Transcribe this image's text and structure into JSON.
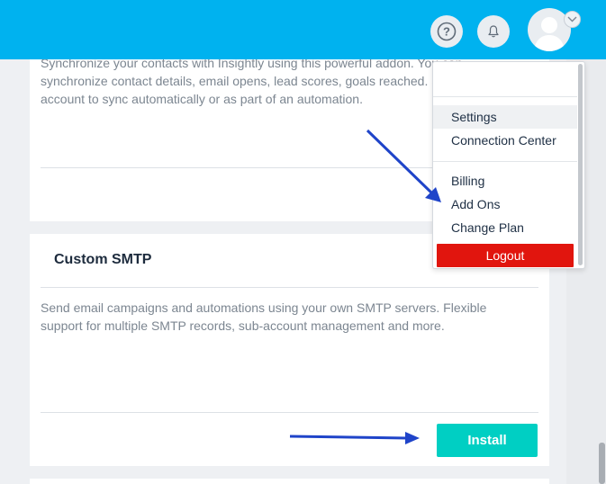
{
  "header": {
    "help_icon": "question-circle-icon",
    "bell_icon": "bell-icon",
    "avatar_icon": "user-avatar",
    "caret_icon": "chevron-down-icon",
    "bg_color": "#00b2ef"
  },
  "cards": [
    {
      "description": "Synchronize your contacts with Insightly using this powerful addon. You can synchronize contact details, email opens, lead scores, goals reached. Setup the account to sync automatically or as part of an automation."
    },
    {
      "title": "Custom SMTP",
      "description": "Send email campaigns and automations using your own SMTP servers. Flexible support for multiple SMTP records, sub-account management and more.",
      "button_label": "Install",
      "button_color": "#00cfc3"
    }
  ],
  "dropdown": {
    "items": [
      {
        "label": "Settings"
      },
      {
        "label": "Connection Center"
      },
      {
        "label": "Billing"
      },
      {
        "label": "Add Ons"
      },
      {
        "label": "Change Plan"
      }
    ],
    "logout_label": "Logout",
    "logout_color": "#e1150e"
  },
  "annotations": {
    "arrow_color": "#1f44c9"
  }
}
